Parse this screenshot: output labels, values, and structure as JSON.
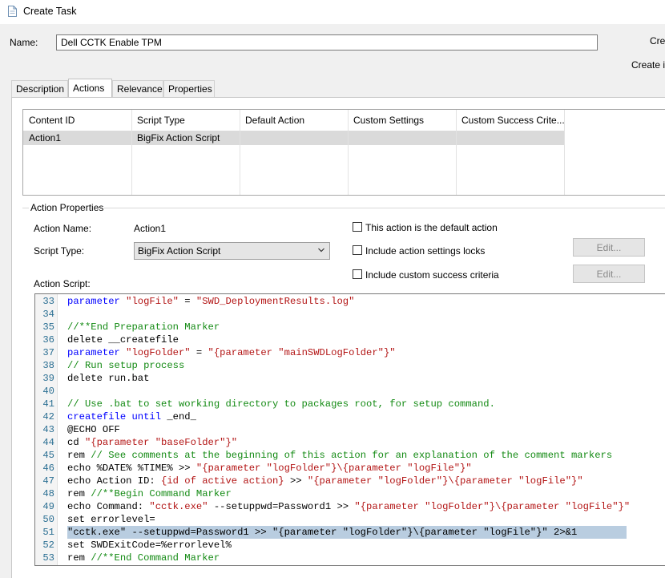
{
  "window": {
    "title": "Create Task"
  },
  "name_field": {
    "label": "Name:",
    "value": "Dell CCTK Enable TPM"
  },
  "right_fragments": {
    "create_top": "Cre",
    "create_bottom": "Create i"
  },
  "tabs": [
    {
      "label": "Description"
    },
    {
      "label": "Actions"
    },
    {
      "label": "Relevance"
    },
    {
      "label": "Properties"
    }
  ],
  "active_tab": "Actions",
  "actions_grid": {
    "columns": [
      "Content ID",
      "Script Type",
      "Default Action",
      "Custom Settings",
      "Custom Success Crite..."
    ],
    "rows": [
      [
        "Action1",
        "BigFix Action Script",
        "",
        "",
        ""
      ]
    ]
  },
  "action_properties": {
    "group_label": "Action Properties",
    "action_name_label": "Action Name:",
    "action_name_value": "Action1",
    "script_type_label": "Script Type:",
    "script_type_value": "BigFix Action Script",
    "action_script_label": "Action Script:",
    "checkboxes": [
      {
        "label": "This action is the default action",
        "checked": false
      },
      {
        "label": "Include action settings locks",
        "checked": false
      },
      {
        "label": "Include custom success criteria",
        "checked": false
      }
    ],
    "edit_buttons": [
      {
        "label": "Edit..."
      },
      {
        "label": "Edit..."
      }
    ]
  },
  "script_lines": [
    {
      "n": "33",
      "tokens": [
        [
          "kw",
          "parameter "
        ],
        [
          "str",
          "\"logFile\""
        ],
        [
          "pl",
          " = "
        ],
        [
          "str",
          "\"SWD_DeploymentResults.log\""
        ]
      ]
    },
    {
      "n": "34",
      "tokens": []
    },
    {
      "n": "35",
      "tokens": [
        [
          "cm",
          "//**End Preparation Marker"
        ]
      ]
    },
    {
      "n": "36",
      "tokens": [
        [
          "pl",
          "delete __createfile"
        ]
      ]
    },
    {
      "n": "37",
      "tokens": [
        [
          "kw",
          "parameter "
        ],
        [
          "str",
          "\"logFolder\""
        ],
        [
          "pl",
          " = "
        ],
        [
          "str",
          "\"{parameter \"mainSWDLogFolder\"}\""
        ]
      ]
    },
    {
      "n": "38",
      "tokens": [
        [
          "cm",
          "// Run setup process"
        ]
      ]
    },
    {
      "n": "39",
      "tokens": [
        [
          "pl",
          "delete run.bat"
        ]
      ]
    },
    {
      "n": "40",
      "tokens": []
    },
    {
      "n": "41",
      "tokens": [
        [
          "cm",
          "// Use .bat to set working directory to packages root, for setup command."
        ]
      ]
    },
    {
      "n": "42",
      "tokens": [
        [
          "kw",
          "createfile until "
        ],
        [
          "pl",
          "_end_"
        ]
      ]
    },
    {
      "n": "43",
      "tokens": [
        [
          "pl",
          "@ECHO OFF"
        ]
      ]
    },
    {
      "n": "44",
      "tokens": [
        [
          "pl",
          "cd "
        ],
        [
          "str",
          "\"{parameter \"baseFolder\"}\""
        ]
      ]
    },
    {
      "n": "45",
      "tokens": [
        [
          "pl",
          "rem "
        ],
        [
          "cm",
          "// See comments at the beginning of this action for an explanation of the comment markers"
        ]
      ]
    },
    {
      "n": "46",
      "tokens": [
        [
          "pl",
          "echo %DATE% %TIME% >> "
        ],
        [
          "str",
          "\"{parameter \"logFolder\"}\\{parameter \"logFile\"}\""
        ]
      ]
    },
    {
      "n": "47",
      "tokens": [
        [
          "pl",
          "echo Action ID: "
        ],
        [
          "rel",
          "{id of active action}"
        ],
        [
          "pl",
          " >> "
        ],
        [
          "str",
          "\"{parameter \"logFolder\"}\\{parameter \"logFile\"}\""
        ]
      ]
    },
    {
      "n": "48",
      "tokens": [
        [
          "pl",
          "rem "
        ],
        [
          "cm",
          "//**Begin Command Marker"
        ]
      ]
    },
    {
      "n": "49",
      "tokens": [
        [
          "pl",
          "echo Command: "
        ],
        [
          "str",
          "\"cctk.exe\""
        ],
        [
          "pl",
          " --setuppwd=Password1 >> "
        ],
        [
          "str",
          "\"{parameter \"logFolder\"}\\{parameter \"logFile\"}\""
        ]
      ]
    },
    {
      "n": "50",
      "tokens": [
        [
          "pl",
          "set errorlevel="
        ]
      ]
    },
    {
      "n": "51",
      "tokens": [
        [
          "pl",
          "\"cctk.exe\" --setuppwd=Password1 >> \"{parameter \"logFolder\"}\\{parameter \"logFile\"}\" 2>&1"
        ]
      ],
      "selected": true
    },
    {
      "n": "52",
      "tokens": [
        [
          "pl",
          "set SWDExitCode=%errorlevel%"
        ]
      ]
    },
    {
      "n": "53",
      "tokens": [
        [
          "pl",
          "rem "
        ],
        [
          "cm",
          "//**End Command Marker"
        ]
      ]
    }
  ],
  "colors": {
    "keyword": "#0000ff",
    "string": "#b31515",
    "comment": "#138a13",
    "line_number": "#2b6f93",
    "selection": "#b9cde0"
  }
}
